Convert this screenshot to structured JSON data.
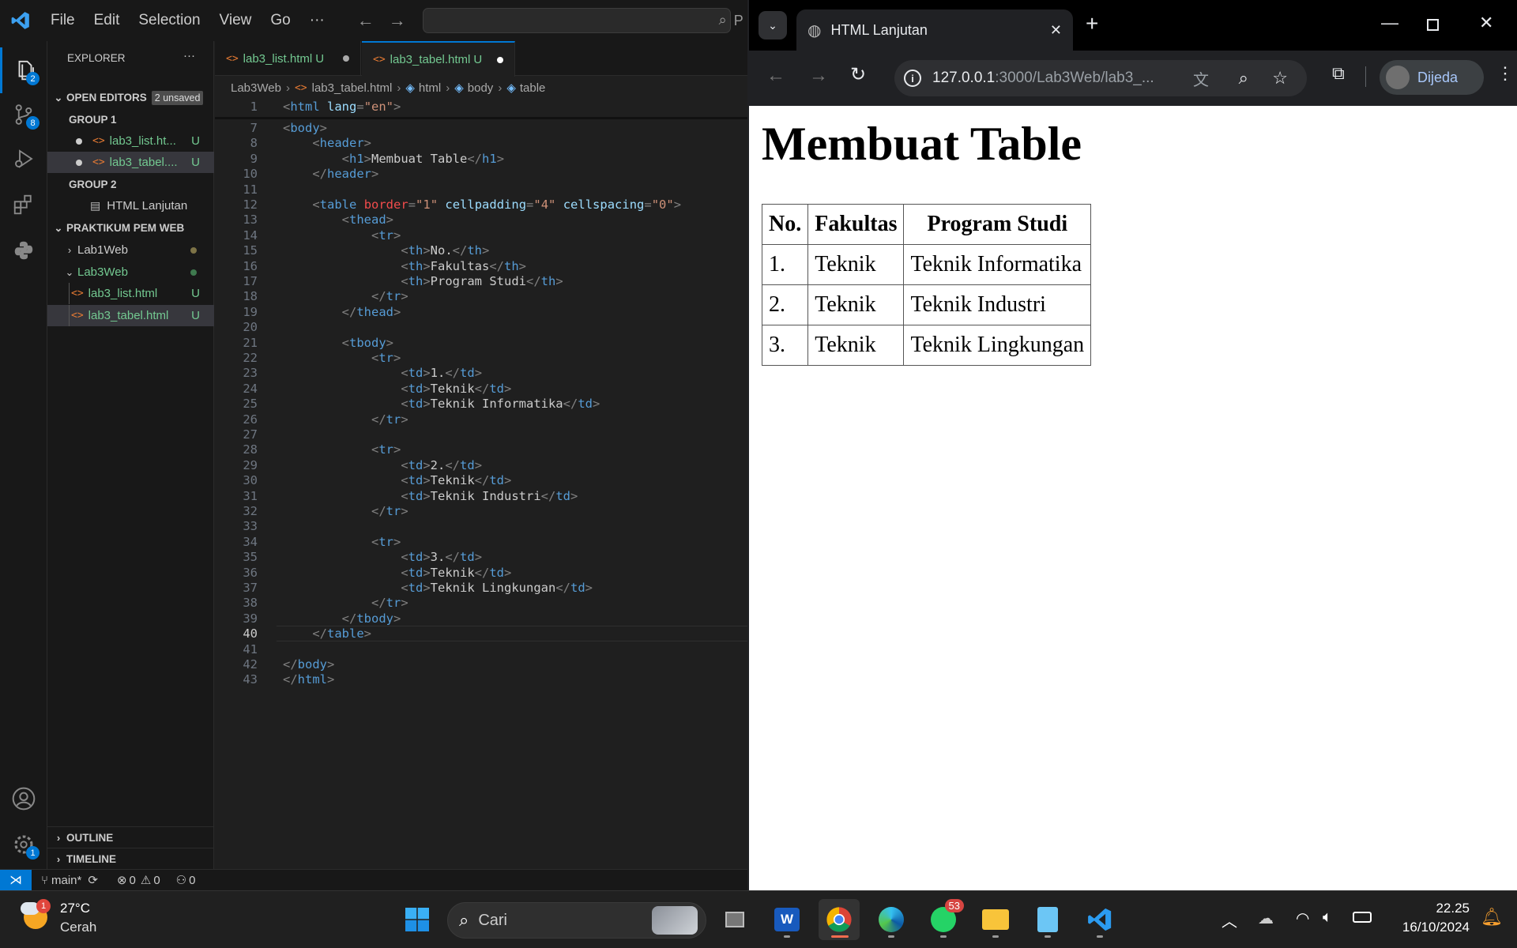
{
  "vscode": {
    "menu": [
      "File",
      "Edit",
      "Selection",
      "View",
      "Go",
      "···"
    ],
    "command_center_hint": "P",
    "activity_badges": {
      "explorer": "2",
      "scm": "8",
      "settings": "1"
    },
    "explorer": {
      "title": "EXPLORER",
      "more": "···",
      "open_editors": "OPEN EDITORS",
      "unsaved_badge": "2 unsaved",
      "group1": "GROUP 1",
      "group1_items": [
        {
          "name": "lab3_list.ht...",
          "status": "U"
        },
        {
          "name": "lab3_tabel....",
          "status": "U"
        }
      ],
      "group2": "GROUP 2",
      "group2_item": "HTML Lanjutan",
      "workspace": "PRAKTIKUM PEM WEB",
      "folders": [
        {
          "name": "Lab1Web"
        },
        {
          "name": "Lab3Web"
        }
      ],
      "files": [
        {
          "name": "lab3_list.html",
          "status": "U"
        },
        {
          "name": "lab3_tabel.html",
          "status": "U"
        }
      ],
      "outline": "OUTLINE",
      "timeline": "TIMELINE"
    },
    "tabs": [
      {
        "name": "lab3_list.html",
        "status": "U"
      },
      {
        "name": "lab3_tabel.html",
        "status": "U"
      }
    ],
    "breadcrumb": [
      "Lab3Web",
      "lab3_tabel.html",
      "html",
      "body",
      "table"
    ],
    "code_lines": [
      {
        "n": "1",
        "t": "<html lang=\"en\">"
      },
      {
        "n": "7",
        "t": "<body>"
      },
      {
        "n": "8",
        "t": "    <header>"
      },
      {
        "n": "9",
        "t": "        <h1>Membuat Table</h1>"
      },
      {
        "n": "10",
        "t": "    </header>"
      },
      {
        "n": "11",
        "t": ""
      },
      {
        "n": "12",
        "t": "    <table border=\"1\" cellpadding=\"4\" cellspacing=\"0\">"
      },
      {
        "n": "13",
        "t": "        <thead>"
      },
      {
        "n": "14",
        "t": "            <tr>"
      },
      {
        "n": "15",
        "t": "                <th>No.</th>"
      },
      {
        "n": "16",
        "t": "                <th>Fakultas</th>"
      },
      {
        "n": "17",
        "t": "                <th>Program Studi</th>"
      },
      {
        "n": "18",
        "t": "            </tr>"
      },
      {
        "n": "19",
        "t": "        </thead>"
      },
      {
        "n": "20",
        "t": ""
      },
      {
        "n": "21",
        "t": "        <tbody>"
      },
      {
        "n": "22",
        "t": "            <tr>"
      },
      {
        "n": "23",
        "t": "                <td>1.</td>"
      },
      {
        "n": "24",
        "t": "                <td>Teknik</td>"
      },
      {
        "n": "25",
        "t": "                <td>Teknik Informatika</td>"
      },
      {
        "n": "26",
        "t": "            </tr>"
      },
      {
        "n": "27",
        "t": ""
      },
      {
        "n": "28",
        "t": "            <tr>"
      },
      {
        "n": "29",
        "t": "                <td>2.</td>"
      },
      {
        "n": "30",
        "t": "                <td>Teknik</td>"
      },
      {
        "n": "31",
        "t": "                <td>Teknik Industri</td>"
      },
      {
        "n": "32",
        "t": "            </tr>"
      },
      {
        "n": "33",
        "t": ""
      },
      {
        "n": "34",
        "t": "            <tr>"
      },
      {
        "n": "35",
        "t": "                <td>3.</td>"
      },
      {
        "n": "36",
        "t": "                <td>Teknik</td>"
      },
      {
        "n": "37",
        "t": "                <td>Teknik Lingkungan</td>"
      },
      {
        "n": "38",
        "t": "            </tr>"
      },
      {
        "n": "39",
        "t": "        </tbody>"
      },
      {
        "n": "40",
        "t": "    </table>"
      },
      {
        "n": "41",
        "t": ""
      },
      {
        "n": "42",
        "t": "</body>"
      },
      {
        "n": "43",
        "t": "</html>"
      }
    ],
    "current_line": "40",
    "status": {
      "branch": "main*",
      "errors": "0",
      "warnings": "0",
      "ports": "0"
    }
  },
  "chrome": {
    "tab_title": "HTML Lanjutan",
    "url_host": "127.0.0.1",
    "url_rest": ":3000/Lab3Web/lab3_...",
    "profile": "Dijeda",
    "page": {
      "heading": "Membuat Table",
      "headers": [
        "No.",
        "Fakultas",
        "Program Studi"
      ],
      "rows": [
        [
          "1.",
          "Teknik",
          "Teknik Informatika"
        ],
        [
          "2.",
          "Teknik",
          "Teknik Industri"
        ],
        [
          "3.",
          "Teknik",
          "Teknik Lingkungan"
        ]
      ]
    }
  },
  "taskbar": {
    "weather_temp": "27°C",
    "weather_desc": "Cerah",
    "weather_badge": "1",
    "search_placeholder": "Cari",
    "whatsapp_badge": "53",
    "time": "22.25",
    "date": "16/10/2024"
  },
  "colors": {
    "accent": "#0078d4",
    "untracked": "#73c991",
    "html_icon": "#e37933"
  }
}
